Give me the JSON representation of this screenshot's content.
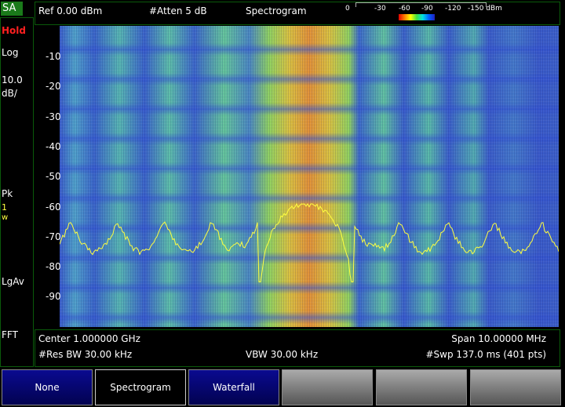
{
  "mode": "SA",
  "left": {
    "hold": "Hold",
    "scale": "Log",
    "div_value": "10.0",
    "div_unit": "dB/",
    "detector": "Pk",
    "trace_num": "1",
    "trace_mode": "w",
    "avg": "LgAv",
    "sweep_type": "FFT"
  },
  "header": {
    "ref": "Ref 0.00 dBm",
    "atten": "#Atten 5 dB",
    "view": "Spectrogram",
    "scale_ticks": [
      "0",
      "-30",
      "-60",
      "-90",
      "-120",
      "-150 dBm"
    ]
  },
  "yaxis": {
    "ticks": [
      "-10",
      "-20",
      "-30",
      "-40",
      "-50",
      "-60",
      "-70",
      "-80",
      "-90"
    ]
  },
  "footer": {
    "center": "Center 1.000000 GHz",
    "span": "Span 10.00000 MHz",
    "rbw": "#Res BW 30.00 kHz",
    "vbw": "VBW 30.00 kHz",
    "sweep": "#Swp 137.0 ms (401 pts)"
  },
  "softkeys": [
    {
      "label": "None"
    },
    {
      "label": "Spectrogram"
    },
    {
      "label": "Waterfall"
    },
    {
      "label": ""
    },
    {
      "label": ""
    },
    {
      "label": ""
    }
  ],
  "trace": {
    "color": "#ffff40",
    "peak_dbm": -59,
    "sidelobe_dbm": -75,
    "floor_dbm": -85
  }
}
